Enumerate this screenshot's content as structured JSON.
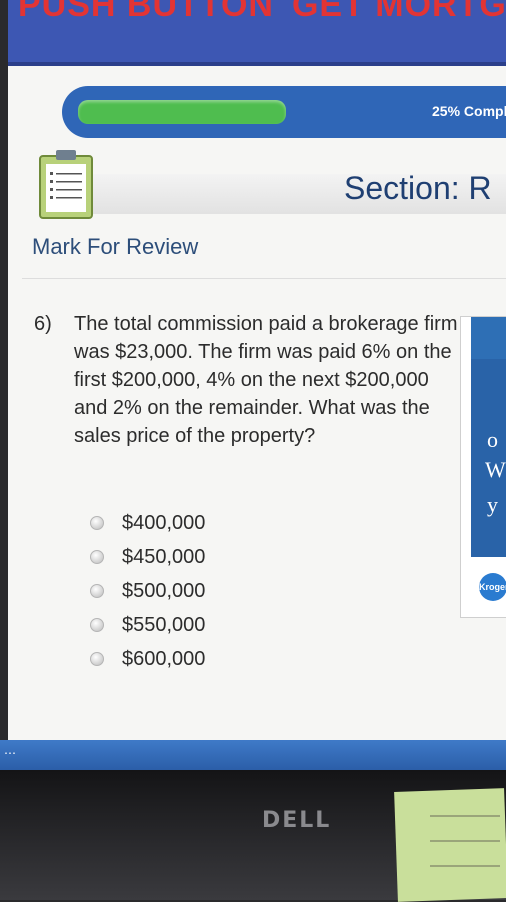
{
  "banner": {
    "left_text": "PUSH BUTTON",
    "right_text": "GET MORTGA"
  },
  "progress": {
    "fraction": 0.25,
    "label": "25% Compl"
  },
  "section": {
    "title": "Section: R"
  },
  "mark_review": "Mark For Review",
  "question": {
    "number": "6)",
    "text": "The total commission paid a brokerage firm was $23,000. The firm was paid 6% on the first $200,000, 4% on the next $200,000 and 2% on the remainder. What was the sales price of the property?",
    "options": [
      {
        "label": "$400,000"
      },
      {
        "label": "$450,000"
      },
      {
        "label": "$500,000"
      },
      {
        "label": "$550,000"
      },
      {
        "label": "$600,000"
      }
    ]
  },
  "side_ad": {
    "letter1": "o",
    "letter2": "W",
    "letter3": "y",
    "logo": "Kroger"
  },
  "monitor": {
    "brand": "DELL"
  },
  "colors": {
    "banner": "#3d57b3",
    "progress_bar": "#2f66b7",
    "progress_fill": "#4fbd4f",
    "section_title": "#1f3f72"
  }
}
